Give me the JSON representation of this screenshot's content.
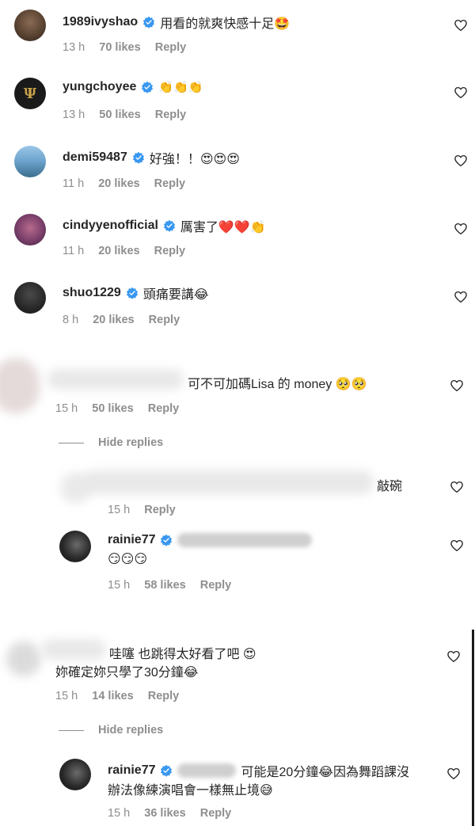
{
  "comments": [
    {
      "username": "1989ivyshao",
      "text": "用看的就爽快感十足🤩",
      "time": "13 h",
      "likes": "70 likes",
      "reply": "Reply"
    },
    {
      "username": "yungchoyee",
      "text": "👏👏👏",
      "time": "13 h",
      "likes": "50 likes",
      "reply": "Reply"
    },
    {
      "username": "demi59487",
      "text": "好強！！😍😍😍",
      "time": "11 h",
      "likes": "20 likes",
      "reply": "Reply"
    },
    {
      "username": "cindyyenofficial",
      "text": "厲害了❤️❤️👏",
      "time": "11 h",
      "likes": "20 likes",
      "reply": "Reply"
    },
    {
      "username": "shuo1229",
      "text": "頭痛要講😂",
      "time": "8 h",
      "likes": "20 likes",
      "reply": "Reply"
    },
    {
      "username": "",
      "text": "可不可加碼Lisa 的 money 🥺🥺",
      "time": "15 h",
      "likes": "50 likes",
      "reply": "Reply"
    }
  ],
  "hide_replies_1": "Hide replies",
  "reply_1": {
    "text": "敲碗",
    "time": "15 h",
    "reply": "Reply"
  },
  "reply_2": {
    "username": "rainie77",
    "text": "😏😏😏",
    "time": "15 h",
    "likes": "58 likes",
    "reply": "Reply"
  },
  "comment_7": {
    "text_line1": "哇噻 也跳得太好看了吧 😍",
    "text_line2": "妳確定妳只學了30分鐘😂",
    "time": "15 h",
    "likes": "14 likes",
    "reply": "Reply"
  },
  "hide_replies_2": "Hide replies",
  "reply_3": {
    "username": "rainie77",
    "text_line1": "可能是20分鐘😂因為舞蹈課沒",
    "text_line2": "辦法像練演唱會一樣無止境😅",
    "time": "15 h",
    "likes": "36 likes",
    "reply": "Reply"
  },
  "icons": {
    "like": "heart-outline-icon",
    "verified": "verified-badge-icon"
  },
  "colors": {
    "verified": "#3897f0",
    "meta": "#8e8e8e",
    "text": "#262626"
  }
}
